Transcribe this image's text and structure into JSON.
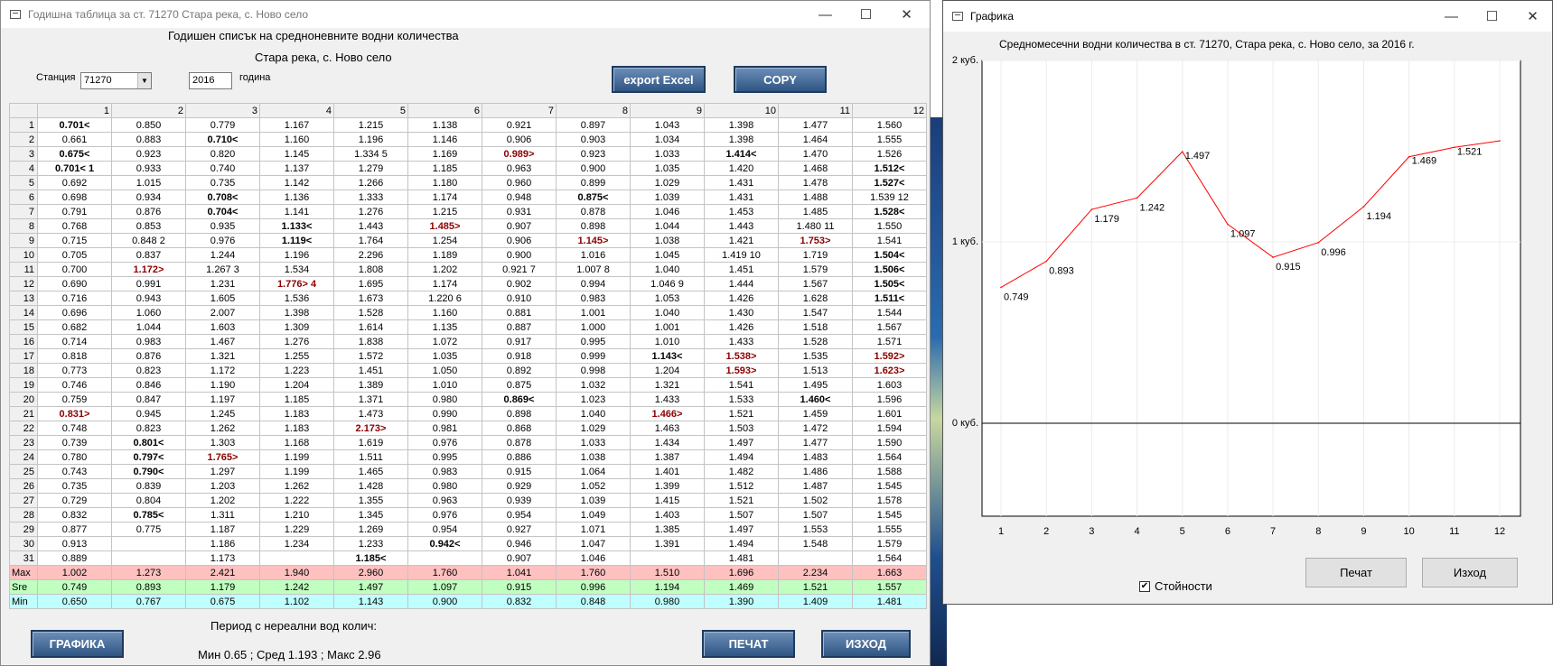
{
  "main_window": {
    "title": "Годишна таблица за ст. 71270  Стара река, с. Ново село",
    "heading": "Годишен списък на средноневните водни количества",
    "subheading": "Стара река, с. Ново село",
    "station_label": "Станция",
    "station_value": "71270",
    "year_value": "2016",
    "year_label": "година",
    "export_label": "export Excel",
    "copy_label": "COPY",
    "graph_label": "ГРАФИКА",
    "print_label": "ПЕЧАТ",
    "exit_label": "ИЗХОД",
    "period_label": "Период с нереални вод колич:",
    "stats_text": "Мин 0.65 ; Сред 1.193 ; Макс 2.96"
  },
  "table": {
    "columns": [
      "1",
      "2",
      "3",
      "4",
      "5",
      "6",
      "7",
      "8",
      "9",
      "10",
      "11",
      "12"
    ],
    "rows": [
      [
        "1",
        "0.701<",
        "0.850",
        "0.779",
        "1.167",
        "1.215",
        "1.138",
        "0.921",
        "0.897",
        "1.043",
        "1.398",
        "1.477",
        "1.560"
      ],
      [
        "2",
        "0.661",
        "0.883",
        "0.710<",
        "1.160",
        "1.196",
        "1.146",
        "0.906",
        "0.903",
        "1.034",
        "1.398",
        "1.464",
        "1.555"
      ],
      [
        "3",
        "0.675<",
        "0.923",
        "0.820",
        "1.145",
        "1.334  5",
        "1.169",
        "0.989>",
        "0.923",
        "1.033",
        "1.414<",
        "1.470",
        "1.526"
      ],
      [
        "4",
        "0.701< 1",
        "0.933",
        "0.740",
        "1.137",
        "1.279",
        "1.185",
        "0.963",
        "0.900",
        "1.035",
        "1.420",
        "1.468",
        "1.512<"
      ],
      [
        "5",
        "0.692",
        "1.015",
        "0.735",
        "1.142",
        "1.266",
        "1.180",
        "0.960",
        "0.899",
        "1.029",
        "1.431",
        "1.478",
        "1.527<"
      ],
      [
        "6",
        "0.698",
        "0.934",
        "0.708<",
        "1.136",
        "1.333",
        "1.174",
        "0.948",
        "0.875<",
        "1.039",
        "1.431",
        "1.488",
        "1.539  12"
      ],
      [
        "7",
        "0.791",
        "0.876",
        "0.704<",
        "1.141",
        "1.276",
        "1.215",
        "0.931",
        "0.878",
        "1.046",
        "1.453",
        "1.485",
        "1.528<"
      ],
      [
        "8",
        "0.768",
        "0.853",
        "0.935",
        "1.133<",
        "1.443",
        "1.485>",
        "0.907",
        "0.898",
        "1.044",
        "1.443",
        "1.480  11",
        "1.550"
      ],
      [
        "9",
        "0.715",
        "0.848  2",
        "0.976",
        "1.119<",
        "1.764",
        "1.254",
        "0.906",
        "1.145>",
        "1.038",
        "1.421",
        "1.753>",
        "1.541"
      ],
      [
        "10",
        "0.705",
        "0.837",
        "1.244",
        "1.196",
        "2.296",
        "1.189",
        "0.900",
        "1.016",
        "1.045",
        "1.419  10",
        "1.719",
        "1.504<"
      ],
      [
        "11",
        "0.700",
        "1.172>",
        "1.267  3",
        "1.534",
        "1.808",
        "1.202",
        "0.921  7",
        "1.007  8",
        "1.040",
        "1.451",
        "1.579",
        "1.506<"
      ],
      [
        "12",
        "0.690",
        "0.991",
        "1.231",
        "1.776> 4",
        "1.695",
        "1.174",
        "0.902",
        "0.994",
        "1.046  9",
        "1.444",
        "1.567",
        "1.505<"
      ],
      [
        "13",
        "0.716",
        "0.943",
        "1.605",
        "1.536",
        "1.673",
        "1.220  6",
        "0.910",
        "0.983",
        "1.053",
        "1.426",
        "1.628",
        "1.511<"
      ],
      [
        "14",
        "0.696",
        "1.060",
        "2.007",
        "1.398",
        "1.528",
        "1.160",
        "0.881",
        "1.001",
        "1.040",
        "1.430",
        "1.547",
        "1.544"
      ],
      [
        "15",
        "0.682",
        "1.044",
        "1.603",
        "1.309",
        "1.614",
        "1.135",
        "0.887",
        "1.000",
        "1.001",
        "1.426",
        "1.518",
        "1.567"
      ],
      [
        "16",
        "0.714",
        "0.983",
        "1.467",
        "1.276",
        "1.838",
        "1.072",
        "0.917",
        "0.995",
        "1.010",
        "1.433",
        "1.528",
        "1.571"
      ],
      [
        "17",
        "0.818",
        "0.876",
        "1.321",
        "1.255",
        "1.572",
        "1.035",
        "0.918",
        "0.999",
        "1.143<",
        "1.538>",
        "1.535",
        "1.592>"
      ],
      [
        "18",
        "0.773",
        "0.823",
        "1.172",
        "1.223",
        "1.451",
        "1.050",
        "0.892",
        "0.998",
        "1.204",
        "1.593>",
        "1.513",
        "1.623>"
      ],
      [
        "19",
        "0.746",
        "0.846",
        "1.190",
        "1.204",
        "1.389",
        "1.010",
        "0.875",
        "1.032",
        "1.321",
        "1.541",
        "1.495",
        "1.603"
      ],
      [
        "20",
        "0.759",
        "0.847",
        "1.197",
        "1.185",
        "1.371",
        "0.980",
        "0.869<",
        "1.023",
        "1.433",
        "1.533",
        "1.460<",
        "1.596"
      ],
      [
        "21",
        "0.831>",
        "0.945",
        "1.245",
        "1.183",
        "1.473",
        "0.990",
        "0.898",
        "1.040",
        "1.466>",
        "1.521",
        "1.459",
        "1.601"
      ],
      [
        "22",
        "0.748",
        "0.823",
        "1.262",
        "1.183",
        "2.173>",
        "0.981",
        "0.868",
        "1.029",
        "1.463",
        "1.503",
        "1.472",
        "1.594"
      ],
      [
        "23",
        "0.739",
        "0.801<",
        "1.303",
        "1.168",
        "1.619",
        "0.976",
        "0.878",
        "1.033",
        "1.434",
        "1.497",
        "1.477",
        "1.590"
      ],
      [
        "24",
        "0.780",
        "0.797<",
        "1.765>",
        "1.199",
        "1.511",
        "0.995",
        "0.886",
        "1.038",
        "1.387",
        "1.494",
        "1.483",
        "1.564"
      ],
      [
        "25",
        "0.743",
        "0.790<",
        "1.297",
        "1.199",
        "1.465",
        "0.983",
        "0.915",
        "1.064",
        "1.401",
        "1.482",
        "1.486",
        "1.588"
      ],
      [
        "26",
        "0.735",
        "0.839",
        "1.203",
        "1.262",
        "1.428",
        "0.980",
        "0.929",
        "1.052",
        "1.399",
        "1.512",
        "1.487",
        "1.545"
      ],
      [
        "27",
        "0.729",
        "0.804",
        "1.202",
        "1.222",
        "1.355",
        "0.963",
        "0.939",
        "1.039",
        "1.415",
        "1.521",
        "1.502",
        "1.578"
      ],
      [
        "28",
        "0.832",
        "0.785<",
        "1.311",
        "1.210",
        "1.345",
        "0.976",
        "0.954",
        "1.049",
        "1.403",
        "1.507",
        "1.507",
        "1.545"
      ],
      [
        "29",
        "0.877",
        "0.775",
        "1.187",
        "1.229",
        "1.269",
        "0.954",
        "0.927",
        "1.071",
        "1.385",
        "1.497",
        "1.553",
        "1.555"
      ],
      [
        "30",
        "0.913",
        "",
        "1.186",
        "1.234",
        "1.233",
        "0.942<",
        "0.946",
        "1.047",
        "1.391",
        "1.494",
        "1.548",
        "1.579"
      ],
      [
        "31",
        "0.889",
        "",
        "1.173",
        "",
        "1.185<",
        "",
        "0.907",
        "1.046",
        "",
        "1.481",
        "",
        "1.564"
      ]
    ],
    "styles": [
      [
        "b",
        "",
        "",
        "",
        "",
        "",
        "",
        "",
        "",
        "",
        "",
        ""
      ],
      [
        "",
        "",
        "b",
        "",
        "",
        "",
        "",
        "",
        "",
        "",
        "",
        ""
      ],
      [
        "b",
        "",
        "",
        "",
        "",
        "",
        "r",
        "",
        "",
        "b",
        "",
        ""
      ],
      [
        "b",
        "",
        "",
        "",
        "",
        "",
        "",
        "",
        "",
        "",
        "",
        "b"
      ],
      [
        "",
        "",
        "",
        "",
        "",
        "",
        "",
        "",
        "",
        "",
        "",
        "b"
      ],
      [
        "",
        "",
        "b",
        "",
        "",
        "",
        "",
        "b",
        "",
        "",
        "",
        ""
      ],
      [
        "",
        "",
        "b",
        "",
        "",
        "",
        "",
        "",
        "",
        "",
        "",
        "b"
      ],
      [
        "",
        "",
        "",
        "b",
        "",
        "r",
        "",
        "",
        "",
        "",
        "",
        ""
      ],
      [
        "",
        "",
        "",
        "b",
        "",
        "",
        "",
        "r",
        "",
        "",
        "r",
        ""
      ],
      [
        "",
        "",
        "",
        "",
        "",
        "",
        "",
        "",
        "",
        "",
        "",
        "b"
      ],
      [
        "",
        "r",
        "",
        "",
        "",
        "",
        "",
        "",
        "",
        "",
        "",
        "b"
      ],
      [
        "",
        "",
        "",
        "r",
        "",
        "",
        "",
        "",
        "",
        "",
        "",
        "b"
      ],
      [
        "",
        "",
        "",
        "",
        "",
        "",
        "",
        "",
        "",
        "",
        "",
        "b"
      ],
      [
        "",
        "",
        "",
        "",
        "",
        "",
        "",
        "",
        "",
        "",
        "",
        ""
      ],
      [
        "",
        "",
        "",
        "",
        "",
        "",
        "",
        "",
        "",
        "",
        "",
        ""
      ],
      [
        "",
        "",
        "",
        "",
        "",
        "",
        "",
        "",
        "",
        "",
        "",
        ""
      ],
      [
        "",
        "",
        "",
        "",
        "",
        "",
        "",
        "",
        "b",
        "r",
        "",
        "r"
      ],
      [
        "",
        "",
        "",
        "",
        "",
        "",
        "",
        "",
        "",
        "r",
        "",
        "r"
      ],
      [
        "",
        "",
        "",
        "",
        "",
        "",
        "",
        "",
        "",
        "",
        "",
        ""
      ],
      [
        "",
        "",
        "",
        "",
        "",
        "",
        "b",
        "",
        "",
        "",
        "b",
        ""
      ],
      [
        "r",
        "",
        "",
        "",
        "",
        "",
        "",
        "",
        "r",
        "",
        "",
        ""
      ],
      [
        "",
        "",
        "",
        "",
        "r",
        "",
        "",
        "",
        "",
        "",
        "",
        ""
      ],
      [
        "",
        "b",
        "",
        "",
        "",
        "",
        "",
        "",
        "",
        "",
        "",
        ""
      ],
      [
        "",
        "b",
        "r",
        "",
        "",
        "",
        "",
        "",
        "",
        "",
        "",
        ""
      ],
      [
        "",
        "b",
        "",
        "",
        "",
        "",
        "",
        "",
        "",
        "",
        "",
        ""
      ],
      [
        "",
        "",
        "",
        "",
        "",
        "",
        "",
        "",
        "",
        "",
        "",
        ""
      ],
      [
        "",
        "",
        "",
        "",
        "",
        "",
        "",
        "",
        "",
        "",
        "",
        ""
      ],
      [
        "",
        "b",
        "",
        "",
        "",
        "",
        "",
        "",
        "",
        "",
        "",
        ""
      ],
      [
        "",
        "",
        "",
        "",
        "",
        "",
        "",
        "",
        "",
        "",
        "",
        ""
      ],
      [
        "",
        "",
        "",
        "",
        "",
        "b",
        "",
        "",
        "",
        "",
        "",
        ""
      ],
      [
        "",
        "",
        "",
        "",
        "b",
        "",
        "",
        "",
        "",
        "",
        "",
        ""
      ]
    ],
    "max_row": [
      "Max",
      "1.002",
      "1.273",
      "2.421",
      "1.940",
      "2.960",
      "1.760",
      "1.041",
      "1.760",
      "1.510",
      "1.696",
      "2.234",
      "1.663"
    ],
    "sre_row": [
      "Sre",
      "0.749",
      "0.893",
      "1.179",
      "1.242",
      "1.497",
      "1.097",
      "0.915",
      "0.996",
      "1.194",
      "1.469",
      "1.521",
      "1.557"
    ],
    "min_row": [
      "Min",
      "0.650",
      "0.767",
      "0.675",
      "1.102",
      "1.143",
      "0.900",
      "0.832",
      "0.848",
      "0.980",
      "1.390",
      "1.409",
      "1.481"
    ]
  },
  "graph_window": {
    "title": "Графика",
    "values_label": "Стойности",
    "values_checked": true,
    "print_label": "Печат",
    "exit_label": "Изход"
  },
  "chart_data": {
    "type": "line",
    "title": "Средномесечни водни количества в ст. 71270, Стара река, с. Ново село, за 2016 г.",
    "x": [
      1,
      2,
      3,
      4,
      5,
      6,
      7,
      8,
      9,
      10,
      11,
      12
    ],
    "x_tick_labels": [
      "1",
      "2",
      "3",
      "4",
      "5",
      "6",
      "7",
      "8",
      "9",
      "10",
      "11",
      "12"
    ],
    "y_tick_labels": [
      "2 куб.",
      "1 куб.",
      "0 куб."
    ],
    "y_ticks": [
      2,
      1,
      0
    ],
    "ylim": [
      -0.5,
      2.0
    ],
    "series": [
      {
        "values": [
          0.749,
          0.893,
          1.179,
          1.242,
          1.497,
          1.097,
          0.915,
          0.996,
          1.194,
          1.469,
          1.521,
          1.557
        ],
        "labels": [
          "0.749",
          "0.893",
          "1.179",
          "1.242",
          "1.497",
          "1.097",
          "0.915",
          "0.996",
          "1.194",
          "1.469",
          "1.521",
          ""
        ],
        "color": "#ff0000"
      }
    ],
    "grid": true
  }
}
